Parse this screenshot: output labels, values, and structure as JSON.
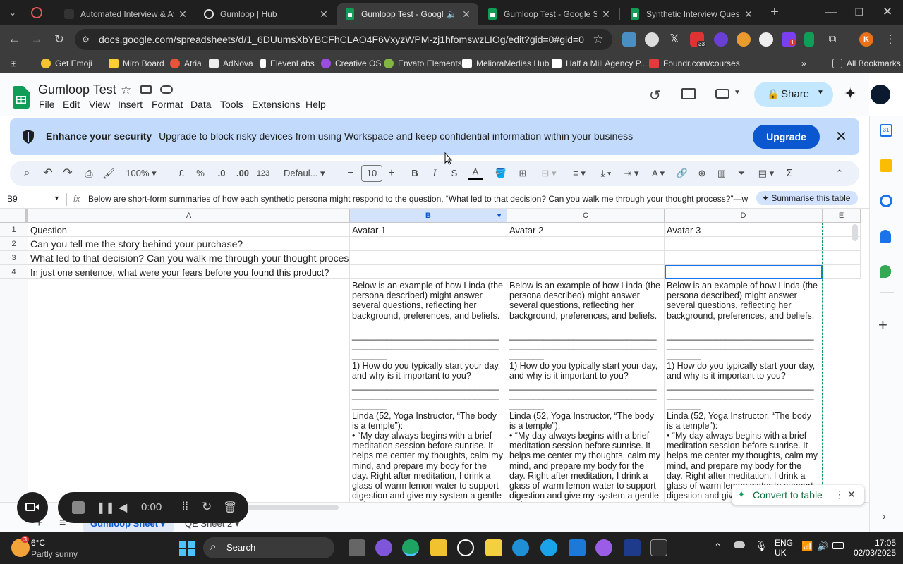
{
  "browser": {
    "tabs": [
      {
        "title": "Automated Interview & Avatar",
        "active": false
      },
      {
        "title": "Gumloop | Hub",
        "active": false
      },
      {
        "title": "Gumloop Test - Google Sheets",
        "active": true
      },
      {
        "title": "Gumloop Test - Google Sheets",
        "active": false
      },
      {
        "title": "Synthetic Interview Questions",
        "active": false
      }
    ],
    "url": "docs.google.com/spreadsheets/d/1_6DUumsXbYBCFhCLAO4F6VxyzWPM-zj1hfomswzLIOg/edit?gid=0#gid=0",
    "bookmarks": [
      "Get Emoji",
      "Miro Board",
      "Atria",
      "AdNova",
      "ElevenLabs",
      "Creative OS",
      "Envato Elements",
      "MelioraMedias Hub",
      "Half a Mill Agency P...",
      "Foundr.com/courses"
    ],
    "all_bookmarks_label": "All Bookmarks",
    "ext_badge_1": "33",
    "ext_badge_2": "1"
  },
  "sheets": {
    "title": "Gumloop Test",
    "menu": [
      "File",
      "Edit",
      "View",
      "Insert",
      "Format",
      "Data",
      "Tools",
      "Extensions",
      "Help"
    ],
    "share_label": "Share",
    "banner": {
      "heading": "Enhance your security",
      "text": "Upgrade to block risky devices from using Workspace and keep confidential information within your business",
      "button": "Upgrade"
    },
    "toolbar": {
      "zoom": "100%",
      "currency": "£",
      "percent": "%",
      "dec_decrease": ".0",
      "dec_increase": ".00",
      "number_format": "123",
      "font": "Defaul...",
      "font_size": "10"
    },
    "formula_bar": {
      "cell_ref": "B9",
      "fx": "fx",
      "content": "Below are short-form summaries of how each synthetic persona might respond to the question, “What led to that decision? Can you walk me through your thought process?”—without revealing",
      "summarise": "Summarise this table"
    },
    "columns": [
      "A",
      "B",
      "C",
      "D",
      "E"
    ],
    "rows": [
      {
        "num": "1",
        "a": "Question",
        "b": "Avatar 1",
        "c": "Avatar 2",
        "d": "Avatar 3"
      },
      {
        "num": "2",
        "a": "Can you tell me the story behind your purchase?",
        "b": "",
        "c": "",
        "d": ""
      },
      {
        "num": "3",
        "a": "What led to that decision? Can you walk me through your thought process?",
        "b": "",
        "c": "",
        "d": ""
      },
      {
        "num": "4",
        "a": "In just one sentence, what were your fears before you found this product?",
        "b": "",
        "c": "",
        "d": ""
      }
    ],
    "long_cell": "Below is an example of how Linda (the persona described) might answer several questions, reflecting her background, preferences, and beliefs.\n\n______________________________\n______________________________\n_______\n1) How do you typically start your day, and why is it important to you?\n______________________________\n______________________________\n_______\nLinda (52, Yoga Instructor, “The body is a temple”):\n• “My day always begins with a brief meditation session before sunrise. It helps me center my thoughts, calm my mind, and prepare my body for the day. Right after meditation, I drink a glass of warm lemon water to support digestion and give my system a gentle wake-up",
    "sheet_tabs": [
      "Gumloop Sheet",
      "QE Sheet 2"
    ],
    "recorder_time": "0:00",
    "convert_label": "Convert to table"
  },
  "taskbar": {
    "weather_temp": "6°C",
    "weather_desc": "Partly sunny",
    "weather_badge": "3",
    "search": "Search",
    "lang1": "ENG",
    "lang2": "UK",
    "time": "17:05",
    "date": "02/03/2025"
  },
  "colors": {
    "accent": "#0b57d0",
    "banner_bg": "#c2dbfc",
    "sheets_green": "#0f9d58",
    "taskbar_bg": "#202020"
  }
}
